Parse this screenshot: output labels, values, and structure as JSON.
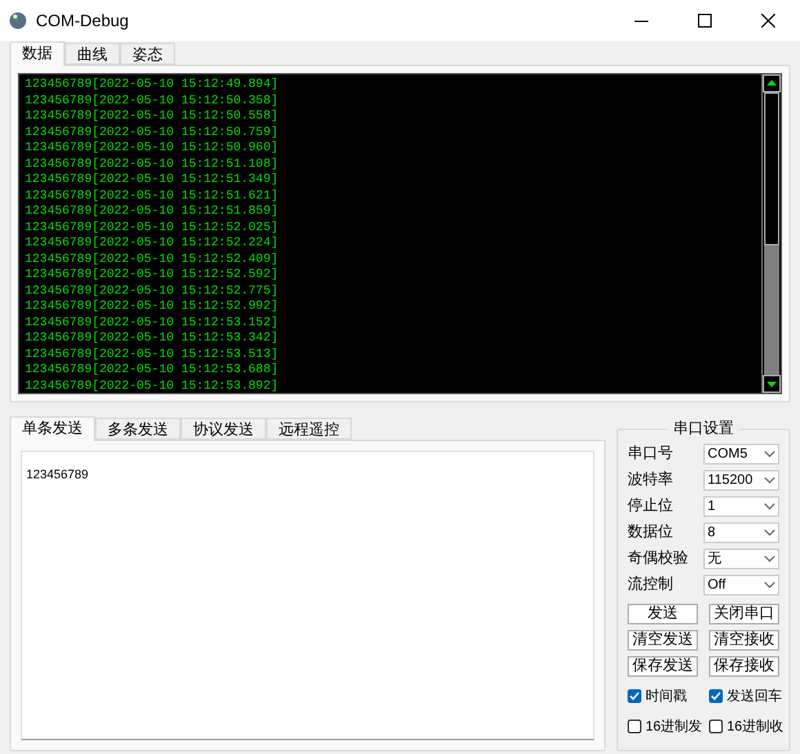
{
  "window": {
    "title": "COM-Debug"
  },
  "top_tabs": [
    {
      "label": "数据",
      "selected": true
    },
    {
      "label": "曲线",
      "selected": false
    },
    {
      "label": "姿态",
      "selected": false
    }
  ],
  "receive_lines": [
    "123456789[2022-05-10 15:12:49.894]",
    "123456789[2022-05-10 15:12:50.358]",
    "123456789[2022-05-10 15:12:50.558]",
    "123456789[2022-05-10 15:12:50.759]",
    "123456789[2022-05-10 15:12:50.960]",
    "123456789[2022-05-10 15:12:51.108]",
    "123456789[2022-05-10 15:12:51.349]",
    "123456789[2022-05-10 15:12:51.621]",
    "123456789[2022-05-10 15:12:51.859]",
    "123456789[2022-05-10 15:12:52.025]",
    "123456789[2022-05-10 15:12:52.224]",
    "123456789[2022-05-10 15:12:52.409]",
    "123456789[2022-05-10 15:12:52.592]",
    "123456789[2022-05-10 15:12:52.775]",
    "123456789[2022-05-10 15:12:52.992]",
    "123456789[2022-05-10 15:12:53.152]",
    "123456789[2022-05-10 15:12:53.342]",
    "123456789[2022-05-10 15:12:53.513]",
    "123456789[2022-05-10 15:12:53.688]",
    "123456789[2022-05-10 15:12:53.892]"
  ],
  "send_tabs": [
    {
      "label": "单条发送",
      "selected": true
    },
    {
      "label": "多条发送",
      "selected": false
    },
    {
      "label": "协议发送",
      "selected": false
    },
    {
      "label": "远程遥控",
      "selected": false
    }
  ],
  "send_text": "123456789",
  "serial_settings": {
    "title": "串口设置",
    "fields": [
      {
        "label": "串口号",
        "value": "COM5"
      },
      {
        "label": "波特率",
        "value": "115200"
      },
      {
        "label": "停止位",
        "value": "1"
      },
      {
        "label": "数据位",
        "value": "8"
      },
      {
        "label": "奇偶校验",
        "value": "无"
      },
      {
        "label": "流控制",
        "value": "Off"
      }
    ],
    "buttons": [
      "发送",
      "关闭串口",
      "清空发送",
      "清空接收",
      "保存发送",
      "保存接收"
    ],
    "checkboxes": [
      {
        "label": "时间戳",
        "checked": true
      },
      {
        "label": "发送回车",
        "checked": true
      },
      {
        "label": "16进制发",
        "checked": false
      },
      {
        "label": "16进制收",
        "checked": false
      }
    ]
  }
}
